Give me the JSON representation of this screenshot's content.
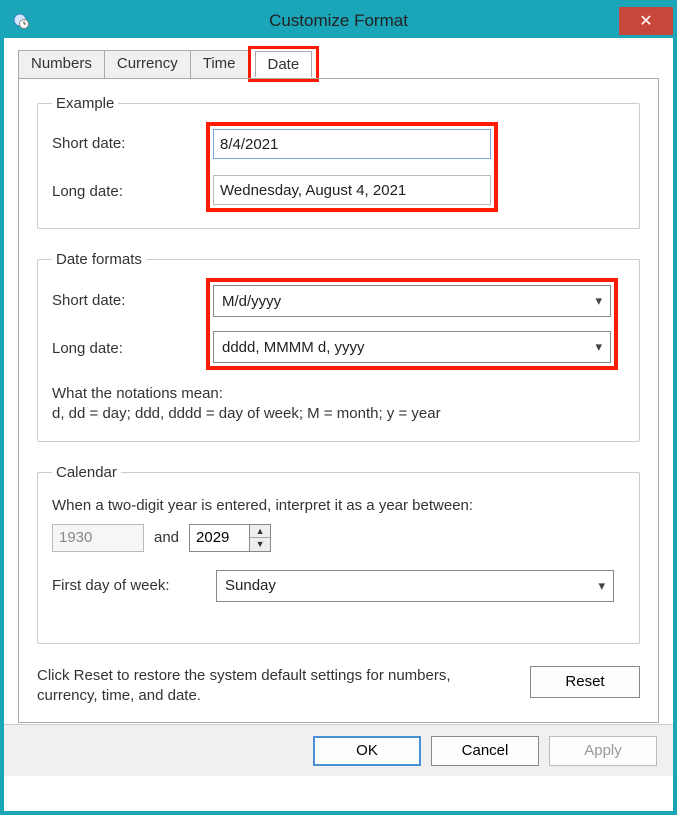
{
  "window": {
    "title": "Customize Format"
  },
  "tabs": {
    "numbers": "Numbers",
    "currency": "Currency",
    "time": "Time",
    "date": "Date"
  },
  "example": {
    "legend": "Example",
    "short_label": "Short date:",
    "long_label": "Long date:",
    "short_value": "8/4/2021",
    "long_value": "Wednesday, August 4, 2021"
  },
  "formats": {
    "legend": "Date formats",
    "short_label": "Short date:",
    "long_label": "Long date:",
    "short_value": "M/d/yyyy",
    "long_value": "dddd, MMMM d, yyyy",
    "notations_title": "What the notations mean:",
    "notations_body": "d, dd = day;  ddd, dddd = day of week;  M = month;  y = year"
  },
  "calendar": {
    "legend": "Calendar",
    "twodigit_text": "When a two-digit year is entered, interpret it as a year between:",
    "year_from": "1930",
    "and": "and",
    "year_to": "2029",
    "firstday_label": "First day of week:",
    "firstday_value": "Sunday"
  },
  "reset": {
    "text": "Click Reset to restore the system default settings for numbers, currency, time, and date.",
    "button": "Reset"
  },
  "footer": {
    "ok": "OK",
    "cancel": "Cancel",
    "apply": "Apply"
  }
}
